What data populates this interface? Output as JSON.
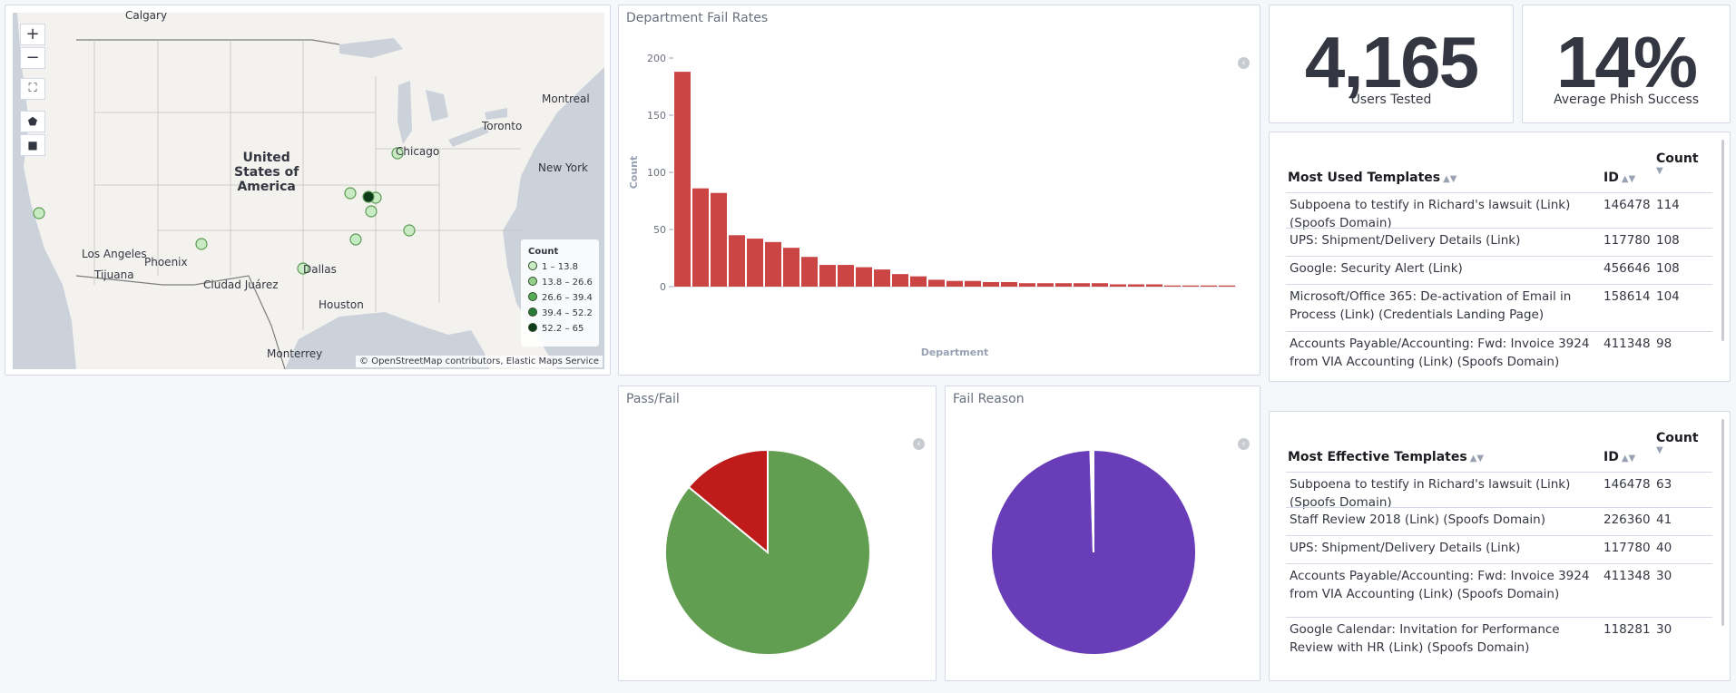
{
  "map": {
    "zoom_in": "+",
    "zoom_out": "−",
    "cities": [
      "Calgary",
      "Montreal",
      "Toronto",
      "Chicago",
      "New York",
      "Los Angeles",
      "Phoenix",
      "Tijuana",
      "Ciudad Juárez",
      "Dallas",
      "Houston",
      "Monterrey"
    ],
    "country_label": [
      "United",
      "States of",
      "America"
    ],
    "legend": {
      "title": "Count",
      "items": [
        {
          "label": "1 – 13.8",
          "color": "#c9ebc4"
        },
        {
          "label": "13.8 – 26.6",
          "color": "#93d08a"
        },
        {
          "label": "26.6 – 39.4",
          "color": "#56ad57"
        },
        {
          "label": "39.4 – 52.2",
          "color": "#277a38"
        },
        {
          "label": "52.2 – 65",
          "color": "#0e3b1a"
        }
      ]
    },
    "attribution": "© OpenStreetMap contributors, Elastic Maps Service"
  },
  "dept_chart": {
    "panel_title": "Department Fail Rates",
    "chart_data": {
      "type": "bar",
      "title": "",
      "xlabel": "Department",
      "ylabel": "Count",
      "ylim": [
        0,
        200
      ],
      "yticks": [
        0,
        50,
        100,
        150,
        200
      ],
      "color": "#cc4545",
      "values": [
        188,
        86,
        82,
        45,
        42,
        39,
        34,
        26,
        19,
        19,
        17,
        15,
        11,
        9,
        6,
        5,
        5,
        4,
        4,
        3,
        3,
        3,
        3,
        3,
        2,
        2,
        2,
        1,
        1,
        1,
        1
      ]
    }
  },
  "kpis": [
    {
      "value": "4,165",
      "label": "Users Tested"
    },
    {
      "value": "14%",
      "label": "Average Phish Success"
    }
  ],
  "used_templates": {
    "headers": [
      "Most Used Templates",
      "ID",
      "Count"
    ],
    "rows": [
      [
        "Subpoena to testify in Richard's lawsuit (Link) (Spoofs Domain)",
        "146478",
        "114"
      ],
      [
        "UPS: Shipment/Delivery Details (Link)",
        "117780",
        "108"
      ],
      [
        "Google: Security Alert (Link)",
        "456646",
        "108"
      ],
      [
        "Microsoft/Office 365: De-activation of Email in Process (Link) (Credentials Landing Page)",
        "158614",
        "104"
      ],
      [
        "Accounts Payable/Accounting: Fwd: Invoice 3924 from VIA Accounting (Link) (Spoofs Domain)",
        "411348",
        "98"
      ]
    ]
  },
  "effective_templates": {
    "headers": [
      "Most Effective Templates",
      "ID",
      "Count"
    ],
    "rows": [
      [
        "Subpoena to testify in Richard's lawsuit (Link) (Spoofs Domain)",
        "146478",
        "63"
      ],
      [
        "Staff Review 2018 (Link) (Spoofs Domain)",
        "226360",
        "41"
      ],
      [
        "UPS: Shipment/Delivery Details (Link)",
        "117780",
        "40"
      ],
      [
        "Accounts Payable/Accounting: Fwd: Invoice 3924 from VIA Accounting (Link) (Spoofs Domain)",
        "411348",
        "30"
      ],
      [
        "Google Calendar: Invitation for Performance Review with HR (Link) (Spoofs Domain)",
        "118281",
        "30"
      ]
    ]
  },
  "pass_fail": {
    "panel_title": "Pass/Fail",
    "chart_data": {
      "type": "pie",
      "slices": [
        {
          "value": 86,
          "color": "#629e51"
        },
        {
          "value": 14,
          "color": "#bf1b1b"
        }
      ]
    }
  },
  "fail_reason": {
    "panel_title": "Fail Reason",
    "chart_data": {
      "type": "pie",
      "slices": [
        {
          "value": 99.5,
          "color": "#6a3db8"
        },
        {
          "value": 0.5,
          "color": "#ffffff"
        }
      ]
    }
  }
}
